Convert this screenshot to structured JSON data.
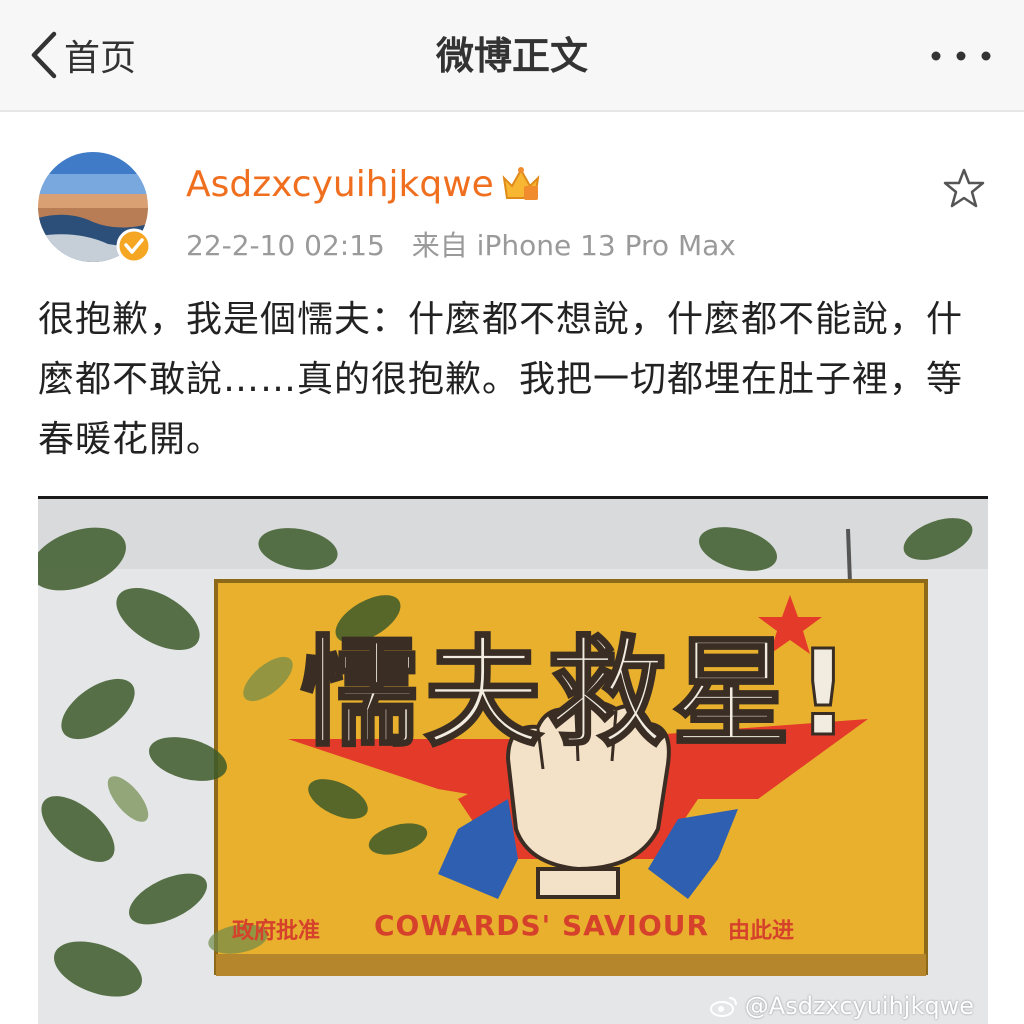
{
  "header": {
    "back_label": "首页",
    "title": "微博正文"
  },
  "post": {
    "username": "Asdzxcyuihjkqwe",
    "date": "22-2-10 02:15",
    "source": "来自 iPhone 13 Pro Max",
    "text": "很抱歉，我是個懦夫：什麼都不想說，什麼都不能說，什麼都不敢說……真的很抱歉。我把一切都埋在肚子裡，等春暖花開。",
    "image": {
      "sign_headline": "懦夫救星!",
      "sign_subtitle": "COWARDS' SAVIOUR",
      "sign_left_small": "政府批准",
      "sign_right_small": "由此进",
      "watermark": "@Asdzxcyuihjkqwe"
    }
  },
  "colors": {
    "username": "#f06f1e",
    "meta": "#9a9a9a",
    "verified_badge": "#f5a623",
    "sign_yellow": "#e8b02c",
    "sign_red": "#e43a2a",
    "sign_blue": "#2f5fb0"
  },
  "icons": {
    "back": "chevron-left-icon",
    "more": "more-dots-icon",
    "favorite": "star-outline-icon",
    "verified": "verified-badge-icon",
    "member": "member-crown-icon"
  }
}
